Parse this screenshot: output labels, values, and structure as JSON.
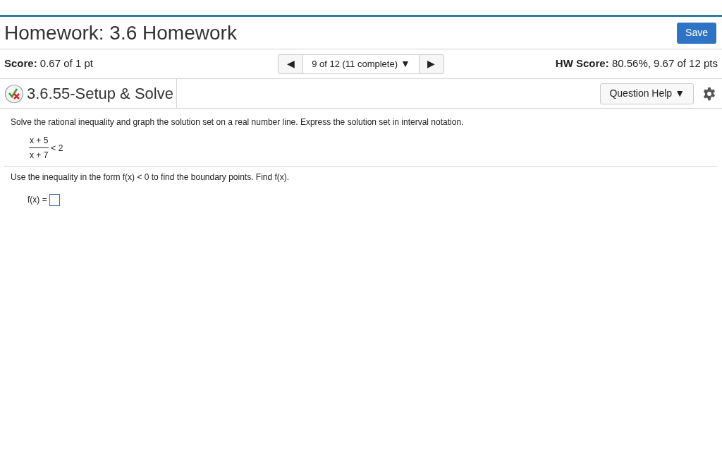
{
  "header": {
    "title": "Homework: 3.6 Homework",
    "save_button": "Save"
  },
  "score_bar": {
    "score_label": "Score:",
    "score_value": "0.67 of 1 pt",
    "prev_arrow": "◀",
    "question_selector": "9 of 12 (11 complete)",
    "selector_caret": "▼",
    "next_arrow": "▶",
    "hw_score_label": "HW Score:",
    "hw_score_value": "80.56%, 9.67 of 12 pts"
  },
  "question_bar": {
    "title": "3.6.55-Setup & Solve",
    "help_button": "Question Help",
    "help_caret": "▼"
  },
  "problem": {
    "instruction": "Solve the rational inequality and graph the solution set on a real number line. Express the solution set in interval notation.",
    "numerator": "x + 5",
    "denominator": "x + 7",
    "relation": "< 2"
  },
  "step": {
    "instruction": "Use the inequality in the form f(x) < 0 to find the boundary points. Find f(x).",
    "answer_label": "f(x) ="
  }
}
